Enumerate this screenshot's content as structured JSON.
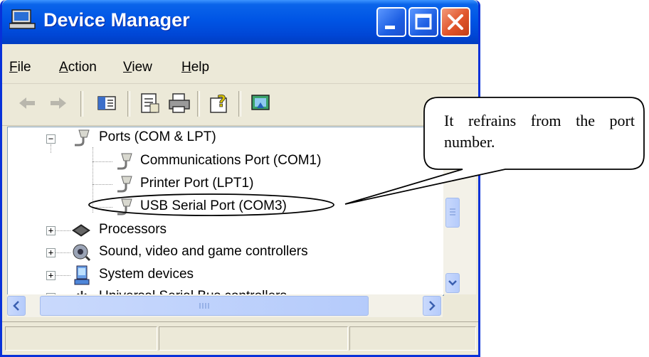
{
  "window": {
    "title": "Device Manager",
    "accent": "#0055e5"
  },
  "menu": [
    "File",
    "Action",
    "View",
    "Help"
  ],
  "toolbar": {
    "icons": [
      "back-icon",
      "forward-icon",
      "show-hide-tree-icon",
      "properties-icon",
      "print-icon",
      "help-icon",
      "device-scan-icon"
    ]
  },
  "tree": {
    "ports": "Ports (COM & LPT)",
    "com1": "Communications Port (COM1)",
    "lpt1": "Printer Port (LPT1)",
    "com3": "USB Serial Port (COM3)",
    "processors": "Processors",
    "sound": "Sound, video and game controllers",
    "system": "System devices",
    "usb": "Universal Serial Bus controllers"
  },
  "callout": {
    "text": "It refrains from the port number."
  }
}
